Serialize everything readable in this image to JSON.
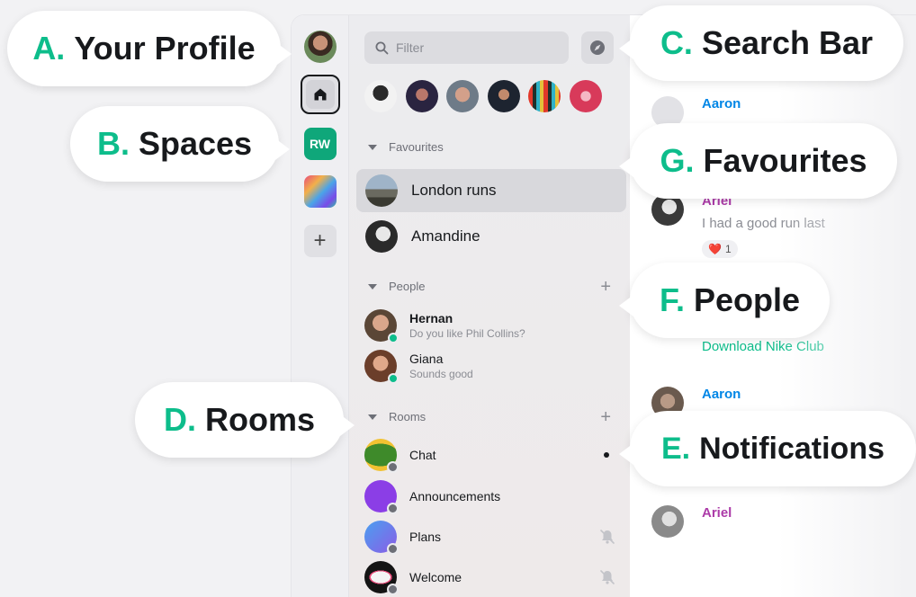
{
  "callouts": {
    "profile": {
      "letter": "A.",
      "text": "Your Profile"
    },
    "spaces": {
      "letter": "B.",
      "text": "Spaces"
    },
    "search": {
      "letter": "C.",
      "text": "Search Bar"
    },
    "rooms": {
      "letter": "D.",
      "text": "Rooms"
    },
    "notifications": {
      "letter": "E.",
      "text": "Notifications"
    },
    "people": {
      "letter": "F.",
      "text": "People"
    },
    "favourites": {
      "letter": "G.",
      "text": "Favourites"
    }
  },
  "spaces_bar": {
    "rw_label": "RW",
    "add_label": "+"
  },
  "search": {
    "placeholder": "Filter"
  },
  "favourites": {
    "header": "Favourites",
    "items": [
      {
        "label": "London runs",
        "selected": true
      },
      {
        "label": "Amandine",
        "selected": false
      }
    ]
  },
  "people": {
    "header": "People",
    "items": [
      {
        "name": "Hernan",
        "preview": "Do you like Phil Collins?",
        "unread": true,
        "online": true
      },
      {
        "name": "Giana",
        "preview": "Sounds good",
        "unread": false,
        "online": true
      }
    ]
  },
  "rooms": {
    "header": "Rooms",
    "items": [
      {
        "label": "Chat",
        "notification": "dot"
      },
      {
        "label": "Announcements",
        "notification": "none"
      },
      {
        "label": "Plans",
        "notification": "muted"
      },
      {
        "label": "Welcome",
        "notification": "muted"
      }
    ]
  },
  "timeline": {
    "messages": [
      {
        "sender": "Aaron",
        "sender_color": "#0086e6"
      },
      {
        "sender": "Ariel",
        "sender_color": "#ac3ba8",
        "body": "I had a good run last",
        "reaction_emoji": "❤️",
        "reaction_count": "1"
      },
      {
        "link": "Download Nike Club"
      },
      {
        "sender": "Aaron",
        "sender_color": "#0086e6"
      },
      {
        "sender": "Ariel",
        "sender_color": "#ac3ba8"
      }
    ]
  },
  "colors": {
    "accent": "#0dbd8b",
    "selected_row": "#d8d8dc",
    "sidebar_bg": "#ececef"
  }
}
